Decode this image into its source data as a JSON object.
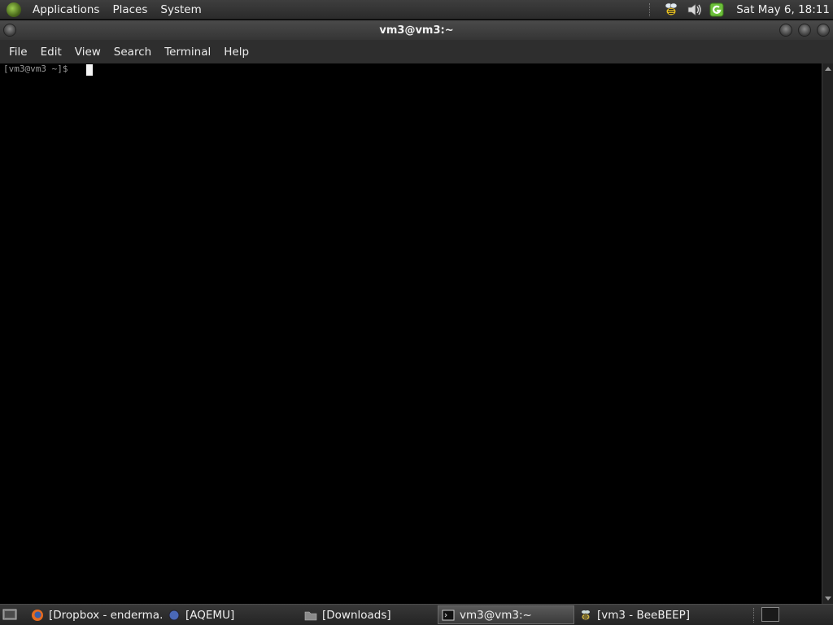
{
  "top_panel": {
    "menus": [
      "Applications",
      "Places",
      "System"
    ],
    "clock": "Sat May  6, 18:11",
    "tray_icons": [
      "beebeep-icon",
      "volume-icon",
      "update-manager-icon"
    ]
  },
  "window": {
    "title": "vm3@vm3:~",
    "menus": [
      "File",
      "Edit",
      "View",
      "Search",
      "Terminal",
      "Help"
    ]
  },
  "terminal": {
    "prompt": "[vm3@vm3 ~]$"
  },
  "taskbar": {
    "tasks": [
      {
        "label": "[Dropbox - enderma...",
        "icon": "firefox-icon",
        "active": false
      },
      {
        "label": "[AQEMU]",
        "icon": "aqemu-icon",
        "active": false
      },
      {
        "label": "[Downloads]",
        "icon": "folder-icon",
        "active": false
      },
      {
        "label": "vm3@vm3:~",
        "icon": "terminal-icon",
        "active": true
      },
      {
        "label": "[vm3 - BeeBEEP]",
        "icon": "beebeep-icon",
        "active": false
      }
    ]
  },
  "colors": {
    "panel": "#2e2e2e",
    "terminal_bg": "#000000",
    "accent_green": "#7cc242"
  }
}
